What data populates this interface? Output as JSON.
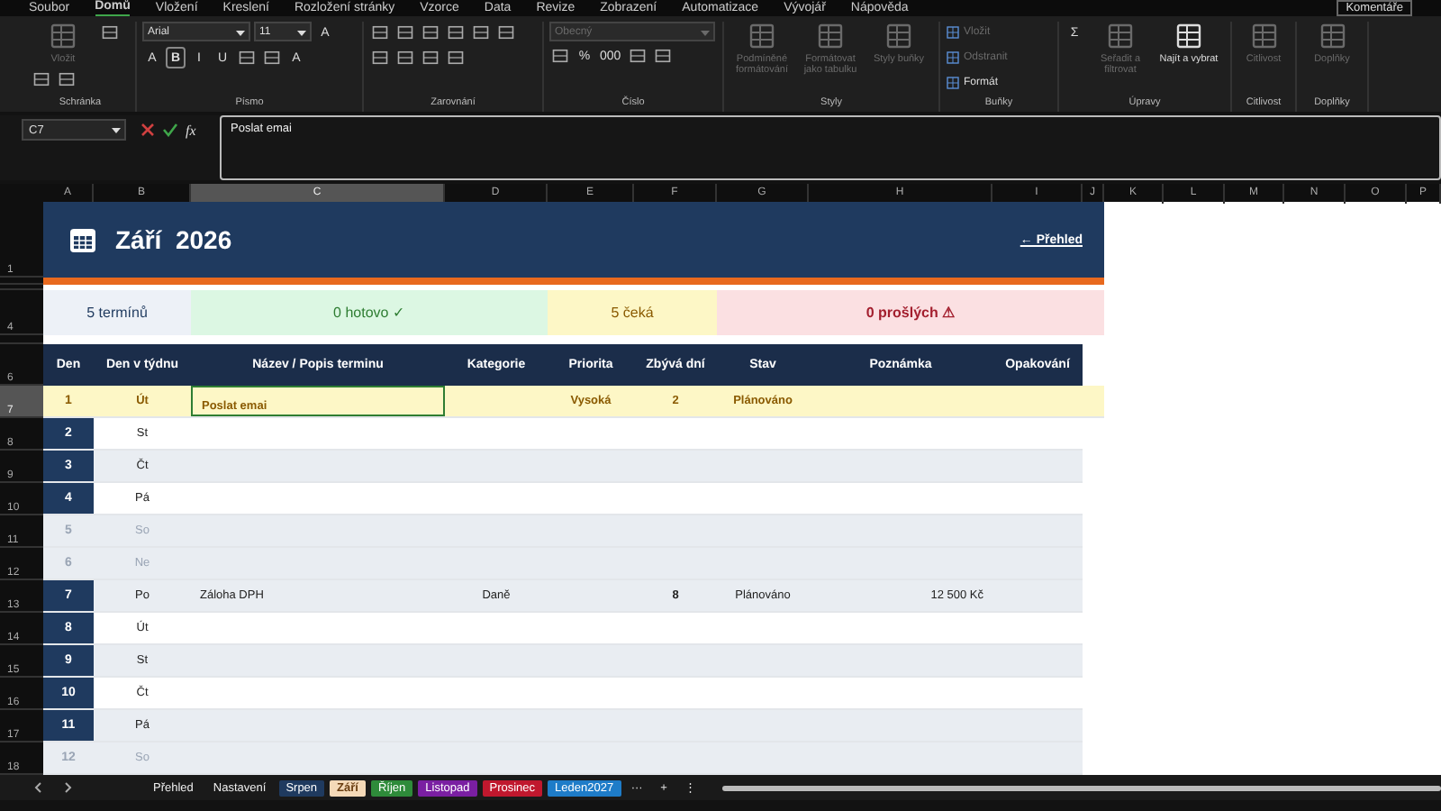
{
  "menu": {
    "tabs": [
      {
        "label": "Soubor",
        "selected": false
      },
      {
        "label": "Domů",
        "selected": true
      },
      {
        "label": "Vložení",
        "selected": false
      },
      {
        "label": "Kreslení",
        "selected": false
      },
      {
        "label": "Rozložení stránky",
        "selected": false
      },
      {
        "label": "Vzorce",
        "selected": false
      },
      {
        "label": "Data",
        "selected": false
      },
      {
        "label": "Revize",
        "selected": false
      },
      {
        "label": "Zobrazení",
        "selected": false
      },
      {
        "label": "Automatizace",
        "selected": false
      },
      {
        "label": "Vývojář",
        "selected": false
      },
      {
        "label": "Nápověda",
        "selected": false
      }
    ],
    "comments_button": "Komentáře"
  },
  "ribbon": {
    "groups": [
      {
        "label": "Schránka",
        "items": [
          {
            "kind": "big",
            "label": "Vložit",
            "disabled": true
          },
          {
            "kind": "icon",
            "disabled": false
          },
          {
            "kind": "icon",
            "disabled": false
          },
          {
            "kind": "icon",
            "disabled": false
          }
        ]
      },
      {
        "label": "Písmo",
        "items": [
          {
            "kind": "field",
            "value": "Arial",
            "disabled": false
          },
          {
            "kind": "field",
            "value": "11",
            "disabled": false
          },
          {
            "kind": "glyph",
            "label": "A",
            "disabled": false,
            "selected": false
          },
          {
            "kind": "glyph",
            "label": "A",
            "disabled": false,
            "selected": false
          },
          {
            "kind": "glyph",
            "label": "B",
            "disabled": false,
            "selected": true
          },
          {
            "kind": "glyph",
            "label": "I",
            "disabled": false,
            "selected": false
          },
          {
            "kind": "glyph",
            "label": "U",
            "disabled": false,
            "selected": false
          },
          {
            "kind": "icon",
            "disabled": false
          },
          {
            "kind": "icon",
            "disabled": false
          },
          {
            "kind": "glyph",
            "label": "A",
            "disabled": false,
            "selected": false
          }
        ]
      },
      {
        "label": "Zarovnání",
        "items": [
          {
            "kind": "icon",
            "disabled": false
          },
          {
            "kind": "icon",
            "disabled": false
          },
          {
            "kind": "icon",
            "disabled": false
          },
          {
            "kind": "icon",
            "disabled": false
          },
          {
            "kind": "icon",
            "disabled": false
          },
          {
            "kind": "icon",
            "disabled": false
          },
          {
            "kind": "icon",
            "disabled": false
          },
          {
            "kind": "icon",
            "disabled": false
          },
          {
            "kind": "icon",
            "disabled": false
          },
          {
            "kind": "icon",
            "disabled": false
          }
        ]
      },
      {
        "label": "Číslo",
        "items": [
          {
            "kind": "field",
            "value": "Obecný",
            "disabled": true
          },
          {
            "kind": "icon",
            "disabled": false
          },
          {
            "kind": "glyph",
            "label": "%",
            "disabled": false,
            "selected": false
          },
          {
            "kind": "glyph",
            "label": "000",
            "disabled": false,
            "selected": false
          },
          {
            "kind": "icon",
            "disabled": false
          },
          {
            "kind": "icon",
            "disabled": false
          }
        ]
      },
      {
        "label": "Styly",
        "items": [
          {
            "kind": "big",
            "label": "Podmíněné formátování",
            "disabled": true
          },
          {
            "kind": "big",
            "label": "Formátovat jako tabulku",
            "disabled": true
          },
          {
            "kind": "big",
            "label": "Styly buňky",
            "disabled": true
          }
        ]
      },
      {
        "label": "Buňky",
        "items": [
          {
            "kind": "small",
            "label": "Vložit",
            "disabled": true
          },
          {
            "kind": "small",
            "label": "Odstranit",
            "disabled": true
          },
          {
            "kind": "small",
            "label": "Formát",
            "disabled": false
          }
        ]
      },
      {
        "label": "Úpravy",
        "items": [
          {
            "kind": "glyph",
            "label": "Σ",
            "disabled": false,
            "selected": false
          },
          {
            "kind": "big",
            "label": "Seřadit a filtrovat",
            "disabled": true
          },
          {
            "kind": "big",
            "label": "Najít a vybrat",
            "disabled": false
          }
        ]
      },
      {
        "label": "Citlivost",
        "items": [
          {
            "kind": "big",
            "label": "Citlivost",
            "disabled": true
          }
        ]
      },
      {
        "label": "Doplňky",
        "items": [
          {
            "kind": "big",
            "label": "Doplňky",
            "disabled": true
          }
        ]
      }
    ]
  },
  "formula_bar": {
    "name_box": "C7",
    "fx": "fx",
    "value": "Poslat emai"
  },
  "columns": [
    {
      "label": "A",
      "selected": false
    },
    {
      "label": "B",
      "selected": false
    },
    {
      "label": "C",
      "selected": true
    },
    {
      "label": "D",
      "selected": false
    },
    {
      "label": "E",
      "selected": false
    },
    {
      "label": "F",
      "selected": false
    },
    {
      "label": "G",
      "selected": false
    },
    {
      "label": "H",
      "selected": false
    },
    {
      "label": "I",
      "selected": false
    },
    {
      "label": "J",
      "selected": false
    },
    {
      "label": "K",
      "selected": false
    },
    {
      "label": "L",
      "selected": false
    },
    {
      "label": "M",
      "selected": false
    },
    {
      "label": "N",
      "selected": false
    },
    {
      "label": "O",
      "selected": false
    },
    {
      "label": "P",
      "selected": false
    }
  ],
  "title": {
    "row": "1",
    "text": "Září  2026",
    "link": "← Přehled"
  },
  "summary": {
    "row": "4",
    "total": "5 termínů",
    "done": "0 hotovo ✓",
    "waiting": "5 čeká",
    "overdue": "0 prošlých ⚠"
  },
  "table": {
    "header_row": "6",
    "columns": [
      "Den",
      "Den v týdnu",
      "Název / Popis terminu",
      "Kategorie",
      "Priorita",
      "Zbývá dní",
      "Stav",
      "Poznámka",
      "Opakování"
    ],
    "rows": [
      {
        "row": "7",
        "day": "1",
        "weekday": "Út",
        "name": "Poslat emai",
        "priority": "Vysoká",
        "days_left": "2",
        "status": "Plánováno",
        "today": true,
        "weekend": false,
        "selected": true
      },
      {
        "row": "8",
        "day": "2",
        "weekday": "St",
        "today": false,
        "weekend": false,
        "selected": false
      },
      {
        "row": "9",
        "day": "3",
        "weekday": "Čt",
        "today": false,
        "weekend": false,
        "selected": false
      },
      {
        "row": "10",
        "day": "4",
        "weekday": "Pá",
        "today": false,
        "weekend": false,
        "selected": false
      },
      {
        "row": "11",
        "day": "5",
        "weekday": "So",
        "today": false,
        "weekend": true,
        "selected": false
      },
      {
        "row": "12",
        "day": "6",
        "weekday": "Ne",
        "today": false,
        "weekend": true,
        "selected": false
      },
      {
        "row": "13",
        "day": "7",
        "weekday": "Po",
        "name": "Záloha DPH",
        "category": "Daně",
        "days_left": "8",
        "status": "Plánováno",
        "note": "12 500 Kč",
        "today": false,
        "weekend": false,
        "selected": false
      },
      {
        "row": "14",
        "day": "8",
        "weekday": "Út",
        "today": false,
        "weekend": false,
        "selected": false
      },
      {
        "row": "15",
        "day": "9",
        "weekday": "St",
        "today": false,
        "weekend": false,
        "selected": false
      },
      {
        "row": "16",
        "day": "10",
        "weekday": "Čt",
        "today": false,
        "weekend": false,
        "selected": false
      },
      {
        "row": "17",
        "day": "11",
        "weekday": "Pá",
        "today": false,
        "weekend": false,
        "selected": false
      },
      {
        "row": "18",
        "day": "12",
        "weekday": "So",
        "today": false,
        "weekend": true,
        "selected": false
      }
    ]
  },
  "sheet_tabs": [
    {
      "label": "Přehled",
      "selected": false
    },
    {
      "label": "Nastavení",
      "selected": false
    },
    {
      "label": "Srpen",
      "selected": false,
      "color": "#1f3a5f"
    },
    {
      "label": "Září",
      "selected": true,
      "color": "#f4d9b8"
    },
    {
      "label": "Říjen",
      "selected": false,
      "color": "#2e8b3a"
    },
    {
      "label": "Listopad",
      "selected": false,
      "color": "#7a1fa2"
    },
    {
      "label": "Prosinec",
      "selected": false,
      "color": "#c0182e"
    },
    {
      "label": "Leden2027",
      "selected": false,
      "color": "#1e7cc8"
    }
  ],
  "sheet_controls": [
    "···",
    "+",
    "⋮"
  ]
}
